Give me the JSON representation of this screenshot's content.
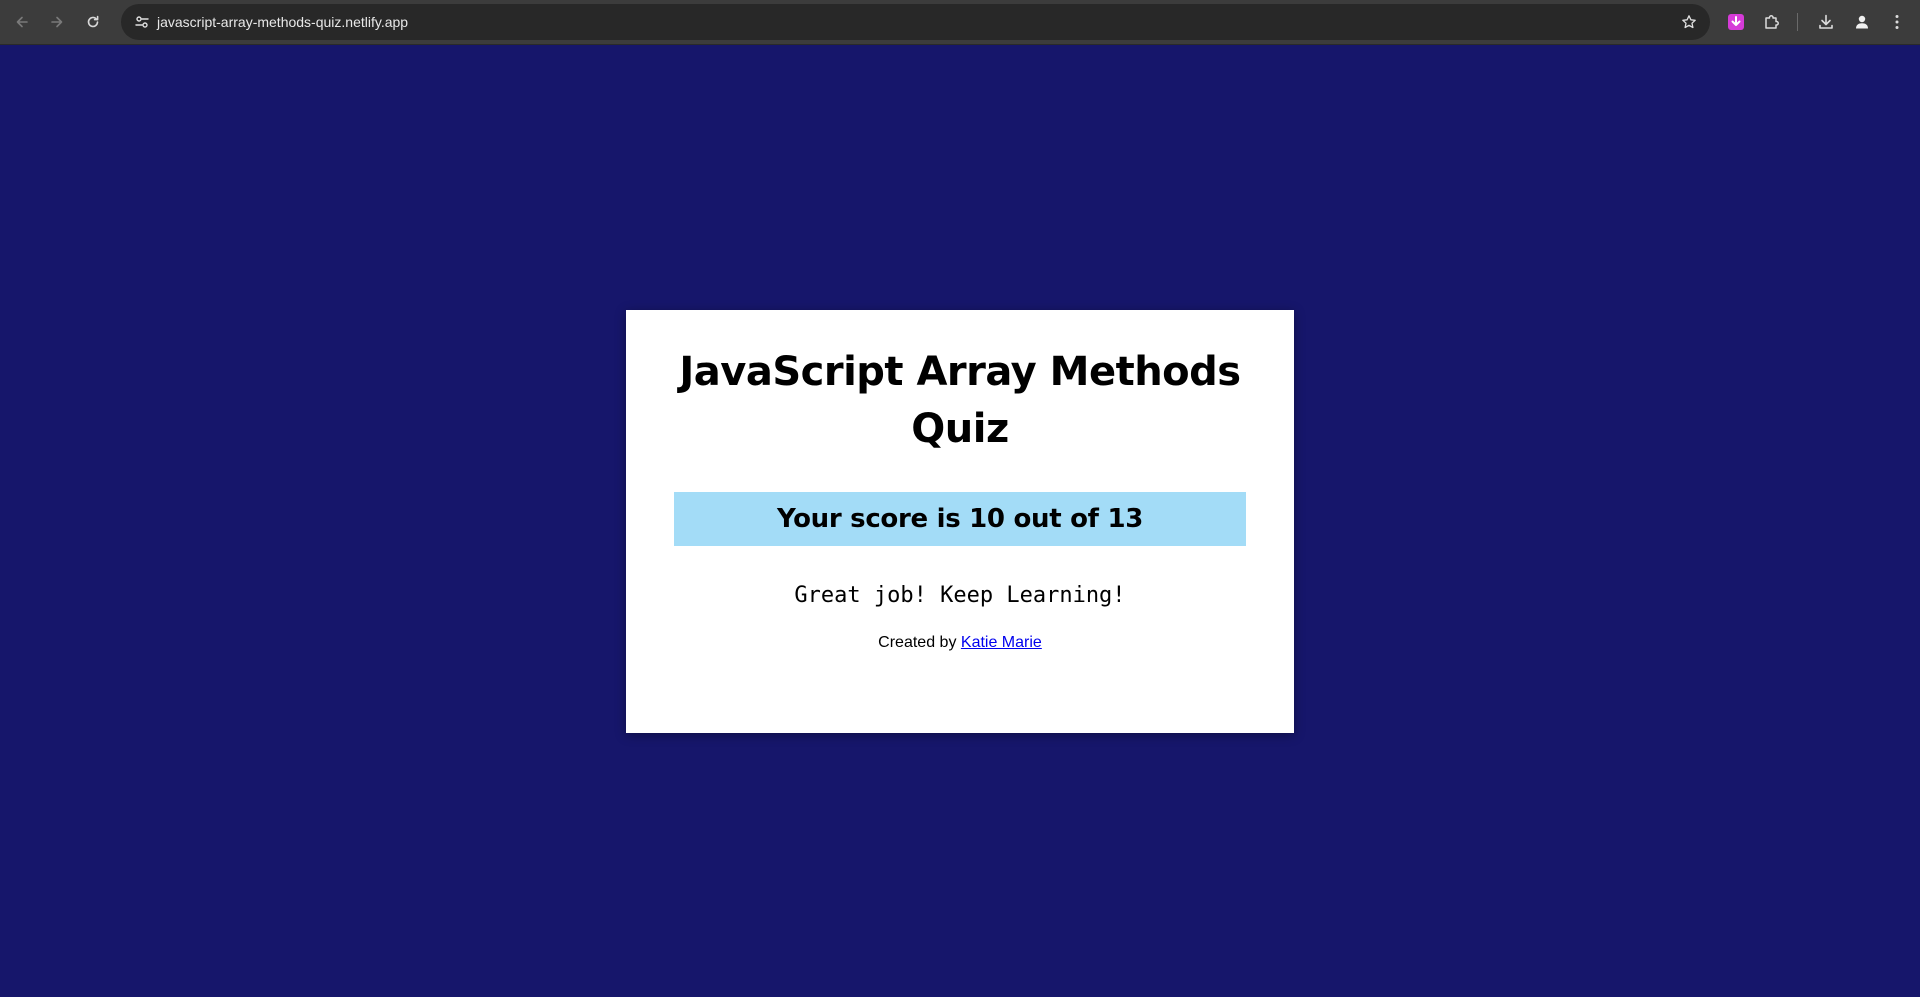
{
  "browser": {
    "url": "javascript-array-methods-quiz.netlify.app",
    "icons": {
      "back": "arrow-left-icon",
      "forward": "arrow-right-icon",
      "reload": "reload-icon",
      "site_info": "tune-icon",
      "bookmark": "star-icon",
      "extension_download": "download-arrow-icon",
      "extensions": "puzzle-icon",
      "downloads": "download-icon",
      "profile": "person-icon",
      "menu": "kebab-menu-icon"
    },
    "colors": {
      "toolbar": "#3c3c3c",
      "omnibox": "#282828",
      "extension_accent": "#d63bd8"
    }
  },
  "page": {
    "background_color": "#16166b",
    "title": "JavaScript Array Methods Quiz",
    "score_text": "Your score is 10 out of 13",
    "score_box_color": "#a3dcf7",
    "message": "Great job! Keep Learning!",
    "credits_prefix": "Created by ",
    "credits_link": "Katie Marie"
  }
}
